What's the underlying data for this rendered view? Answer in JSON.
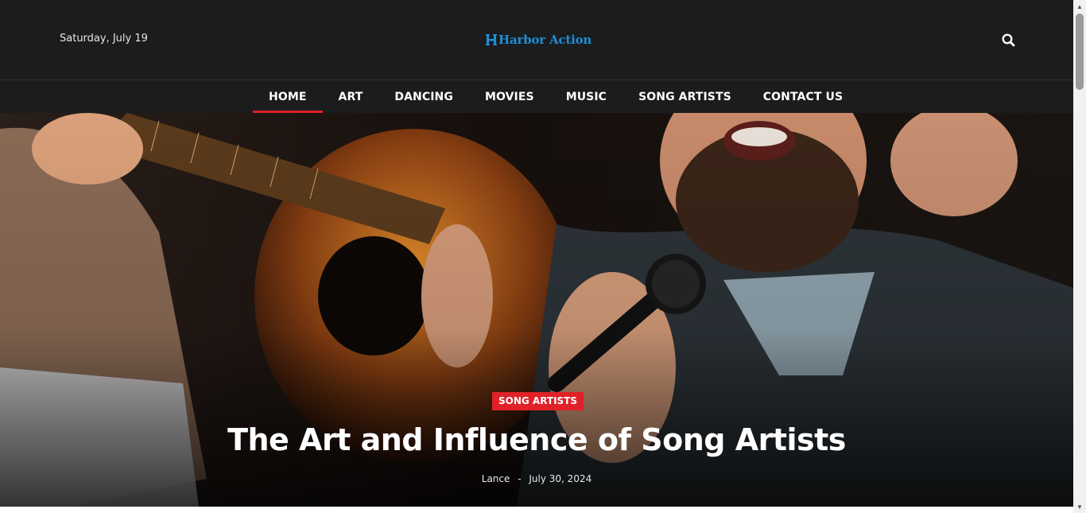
{
  "header": {
    "date": "Saturday, July 19",
    "logo_text": "Harbor Action",
    "search_icon": "search-icon"
  },
  "nav": {
    "items": [
      {
        "label": "HOME",
        "active": true
      },
      {
        "label": "ART"
      },
      {
        "label": "DANCING"
      },
      {
        "label": "MOVIES"
      },
      {
        "label": "MUSIC"
      },
      {
        "label": "SONG ARTISTS"
      },
      {
        "label": "CONTACT US"
      }
    ]
  },
  "hero": {
    "category": "SONG ARTISTS",
    "title": "The Art and Influence of Song Artists",
    "author": "Lance",
    "separator": "-",
    "date": "July 30, 2024"
  },
  "colors": {
    "header_bg": "#1b1c1e",
    "accent_red": "#e02128",
    "logo_blue": "#1e8fd6"
  }
}
